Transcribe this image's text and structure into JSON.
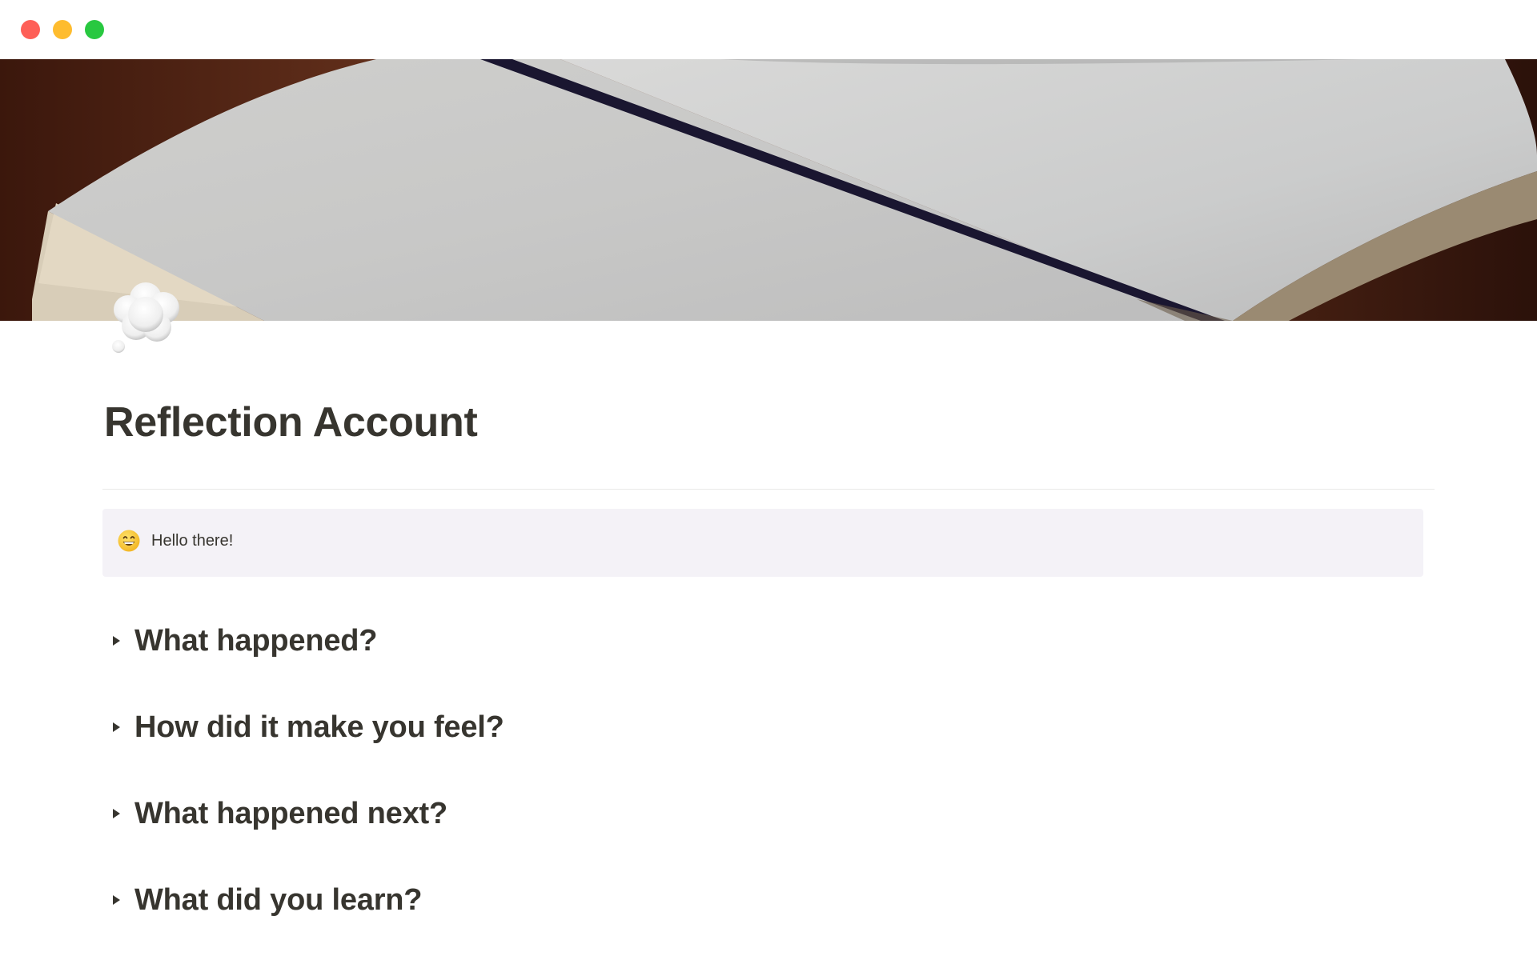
{
  "window": {
    "controls": [
      "close",
      "minimize",
      "zoom"
    ]
  },
  "cover": {
    "description_icon": "open-notebook-photo"
  },
  "page": {
    "icon": "thought-balloon-icon",
    "title": "Reflection Account"
  },
  "callout": {
    "icon": "grinning-face-icon",
    "text": "Hello there!"
  },
  "toggles": [
    {
      "heading": "What happened?"
    },
    {
      "heading": "How did it make you feel?"
    },
    {
      "heading": "What happened next?"
    },
    {
      "heading": "What did you learn?"
    }
  ],
  "colors": {
    "text": "#37352f",
    "callout_bg": "#f4f2f7",
    "divider": "#e9e9e7",
    "close": "#fe5f57",
    "minimize": "#febc2e",
    "zoom": "#28c840"
  }
}
